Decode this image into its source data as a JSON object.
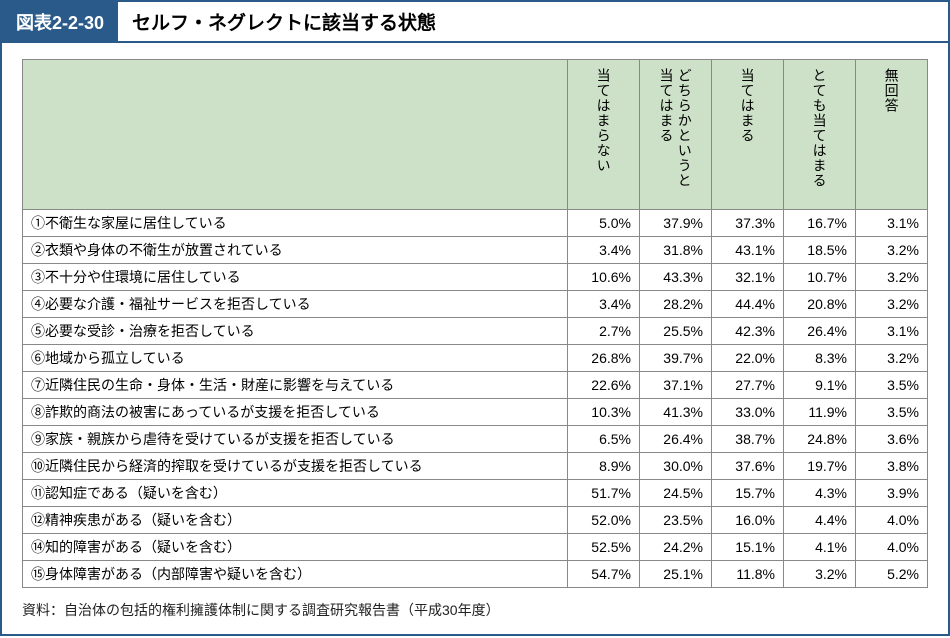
{
  "figure_label": "図表2-2-30",
  "figure_title": "セルフ・ネグレクトに該当する状態",
  "columns": [
    "当てはまらない",
    "どちらかというと当てはまる",
    "当てはまる",
    "とても当てはまる",
    "無回答"
  ],
  "rows": [
    {
      "label": "①不衛生な家屋に居住している",
      "v": [
        "5.0%",
        "37.9%",
        "37.3%",
        "16.7%",
        "3.1%"
      ]
    },
    {
      "label": "②衣類や身体の不衛生が放置されている",
      "v": [
        "3.4%",
        "31.8%",
        "43.1%",
        "18.5%",
        "3.2%"
      ]
    },
    {
      "label": "③不十分や住環境に居住している",
      "v": [
        "10.6%",
        "43.3%",
        "32.1%",
        "10.7%",
        "3.2%"
      ]
    },
    {
      "label": "④必要な介護・福祉サービスを拒否している",
      "v": [
        "3.4%",
        "28.2%",
        "44.4%",
        "20.8%",
        "3.2%"
      ]
    },
    {
      "label": "⑤必要な受診・治療を拒否している",
      "v": [
        "2.7%",
        "25.5%",
        "42.3%",
        "26.4%",
        "3.1%"
      ]
    },
    {
      "label": "⑥地域から孤立している",
      "v": [
        "26.8%",
        "39.7%",
        "22.0%",
        "8.3%",
        "3.2%"
      ]
    },
    {
      "label": "⑦近隣住民の生命・身体・生活・財産に影響を与えている",
      "v": [
        "22.6%",
        "37.1%",
        "27.7%",
        "9.1%",
        "3.5%"
      ]
    },
    {
      "label": "⑧詐欺的商法の被害にあっているが支援を拒否している",
      "v": [
        "10.3%",
        "41.3%",
        "33.0%",
        "11.9%",
        "3.5%"
      ]
    },
    {
      "label": "⑨家族・親族から虐待を受けているが支援を拒否している",
      "v": [
        "6.5%",
        "26.4%",
        "38.7%",
        "24.8%",
        "3.6%"
      ]
    },
    {
      "label": "⑩近隣住民から経済的搾取を受けているが支援を拒否している",
      "v": [
        "8.9%",
        "30.0%",
        "37.6%",
        "19.7%",
        "3.8%"
      ]
    },
    {
      "label": "⑪認知症である（疑いを含む）",
      "v": [
        "51.7%",
        "24.5%",
        "15.7%",
        "4.3%",
        "3.9%"
      ]
    },
    {
      "label": "⑫精神疾患がある（疑いを含む）",
      "v": [
        "52.0%",
        "23.5%",
        "16.0%",
        "4.4%",
        "4.0%"
      ]
    },
    {
      "label": "⑭知的障害がある（疑いを含む）",
      "v": [
        "52.5%",
        "24.2%",
        "15.1%",
        "4.1%",
        "4.0%"
      ]
    },
    {
      "label": "⑮身体障害がある（内部障害や疑いを含む）",
      "v": [
        "54.7%",
        "25.1%",
        "11.8%",
        "3.2%",
        "5.2%"
      ]
    }
  ],
  "source": "資料：自治体の包括的権利擁護体制に関する調査研究報告書（平成30年度）",
  "chart_data": {
    "type": "table",
    "title": "セルフ・ネグレクトに該当する状態",
    "columns": [
      "当てはまらない",
      "どちらかというと当てはまる",
      "当てはまる",
      "とても当てはまる",
      "無回答"
    ],
    "rows": [
      {
        "category": "①不衛生な家屋に居住している",
        "values": [
          5.0,
          37.9,
          37.3,
          16.7,
          3.1
        ]
      },
      {
        "category": "②衣類や身体の不衛生が放置されている",
        "values": [
          3.4,
          31.8,
          43.1,
          18.5,
          3.2
        ]
      },
      {
        "category": "③不十分や住環境に居住している",
        "values": [
          10.6,
          43.3,
          32.1,
          10.7,
          3.2
        ]
      },
      {
        "category": "④必要な介護・福祉サービスを拒否している",
        "values": [
          3.4,
          28.2,
          44.4,
          20.8,
          3.2
        ]
      },
      {
        "category": "⑤必要な受診・治療を拒否している",
        "values": [
          2.7,
          25.5,
          42.3,
          26.4,
          3.1
        ]
      },
      {
        "category": "⑥地域から孤立している",
        "values": [
          26.8,
          39.7,
          22.0,
          8.3,
          3.2
        ]
      },
      {
        "category": "⑦近隣住民の生命・身体・生活・財産に影響を与えている",
        "values": [
          22.6,
          37.1,
          27.7,
          9.1,
          3.5
        ]
      },
      {
        "category": "⑧詐欺的商法の被害にあっているが支援を拒否している",
        "values": [
          10.3,
          41.3,
          33.0,
          11.9,
          3.5
        ]
      },
      {
        "category": "⑨家族・親族から虐待を受けているが支援を拒否している",
        "values": [
          6.5,
          26.4,
          38.7,
          24.8,
          3.6
        ]
      },
      {
        "category": "⑩近隣住民から経済的搾取を受けているが支援を拒否している",
        "values": [
          8.9,
          30.0,
          37.6,
          19.7,
          3.8
        ]
      },
      {
        "category": "⑪認知症である（疑いを含む）",
        "values": [
          51.7,
          24.5,
          15.7,
          4.3,
          3.9
        ]
      },
      {
        "category": "⑫精神疾患がある（疑いを含む）",
        "values": [
          52.0,
          23.5,
          16.0,
          4.4,
          4.0
        ]
      },
      {
        "category": "⑭知的障害がある（疑いを含む）",
        "values": [
          52.5,
          24.2,
          15.1,
          4.1,
          4.0
        ]
      },
      {
        "category": "⑮身体障害がある（内部障害や疑いを含む）",
        "values": [
          54.7,
          25.1,
          11.8,
          3.2,
          5.2
        ]
      }
    ],
    "unit": "%"
  }
}
